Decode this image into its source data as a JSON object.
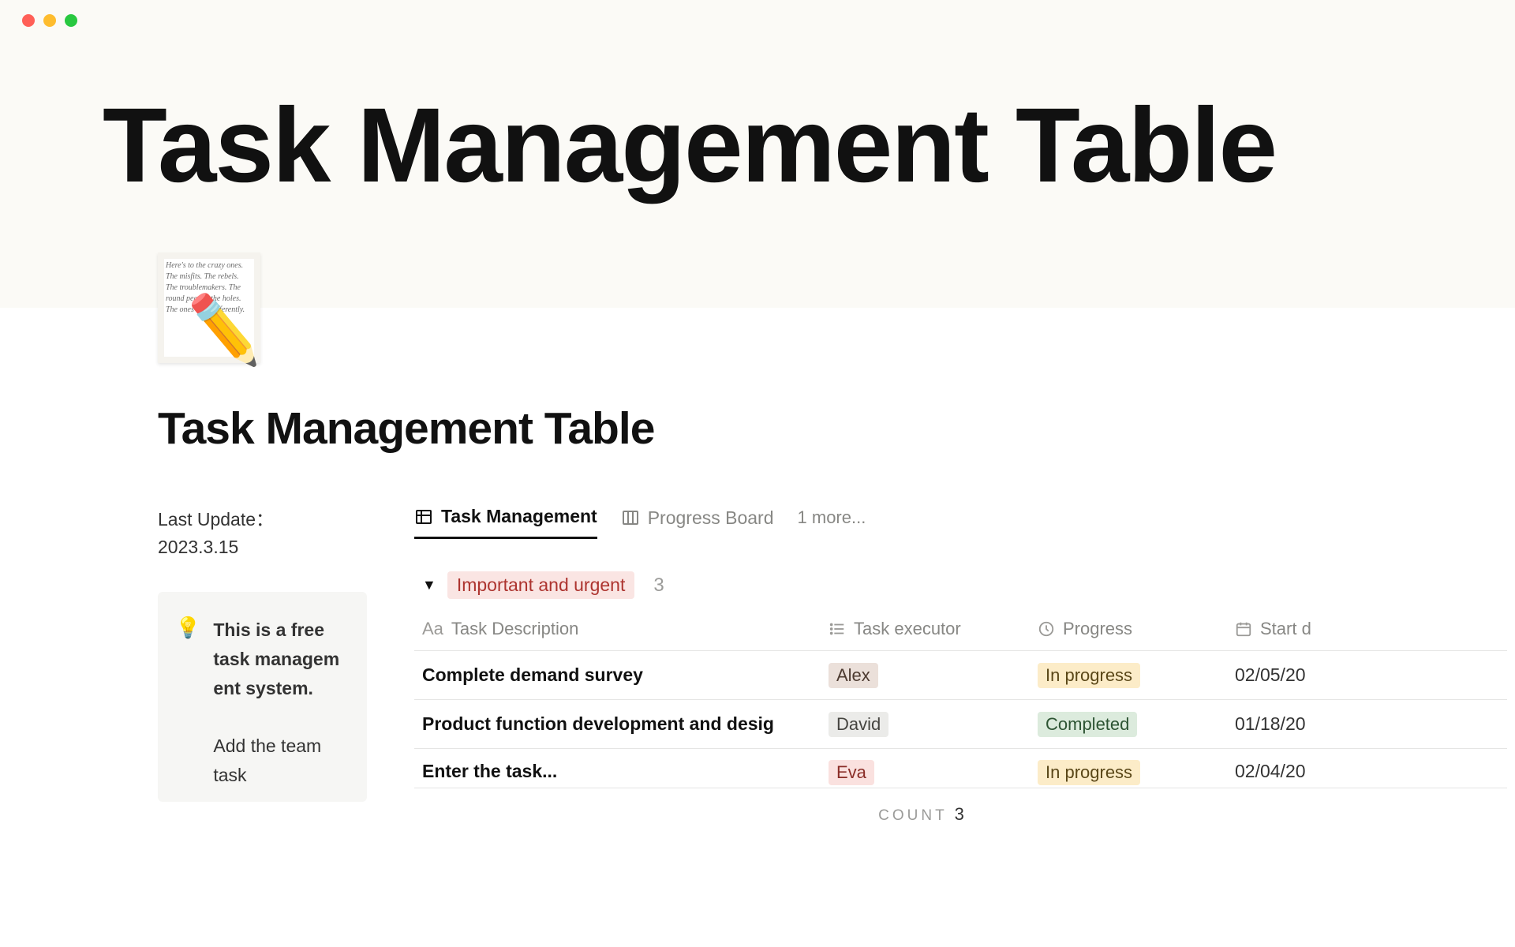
{
  "header": {
    "title": "Task Management Table"
  },
  "page": {
    "title": "Task Management Table"
  },
  "sidebar": {
    "lastUpdateLabel": "Last Update：",
    "lastUpdateDate": "2023.3.15",
    "infoBold": "This is a free task managem ent system.",
    "infoRest": "Add the team task"
  },
  "tabs": {
    "taskManagement": "Task Management",
    "progressBoard": "Progress Board",
    "more": "1 more..."
  },
  "group": {
    "badge": "Important and urgent",
    "count": "3"
  },
  "columns": {
    "description": "Task Description",
    "executor": "Task executor",
    "progress": "Progress",
    "start": "Start d"
  },
  "rows": [
    {
      "description": "Complete demand survey",
      "executor": "Alex",
      "executorClass": "tag-alex",
      "progress": "In progress",
      "progressClass": "tag-inprogress",
      "start": "02/05/20"
    },
    {
      "description": "Product function development and desig",
      "executor": "David",
      "executorClass": "tag-david",
      "progress": "Completed",
      "progressClass": "tag-completed",
      "start": "01/18/20"
    },
    {
      "description": "Enter the task...",
      "executor": "Eva",
      "executorClass": "tag-eva",
      "progress": "In progress",
      "progressClass": "tag-inprogress",
      "start": "02/04/20"
    }
  ],
  "footer": {
    "countLabel": "COUNT",
    "countValue": "3"
  }
}
